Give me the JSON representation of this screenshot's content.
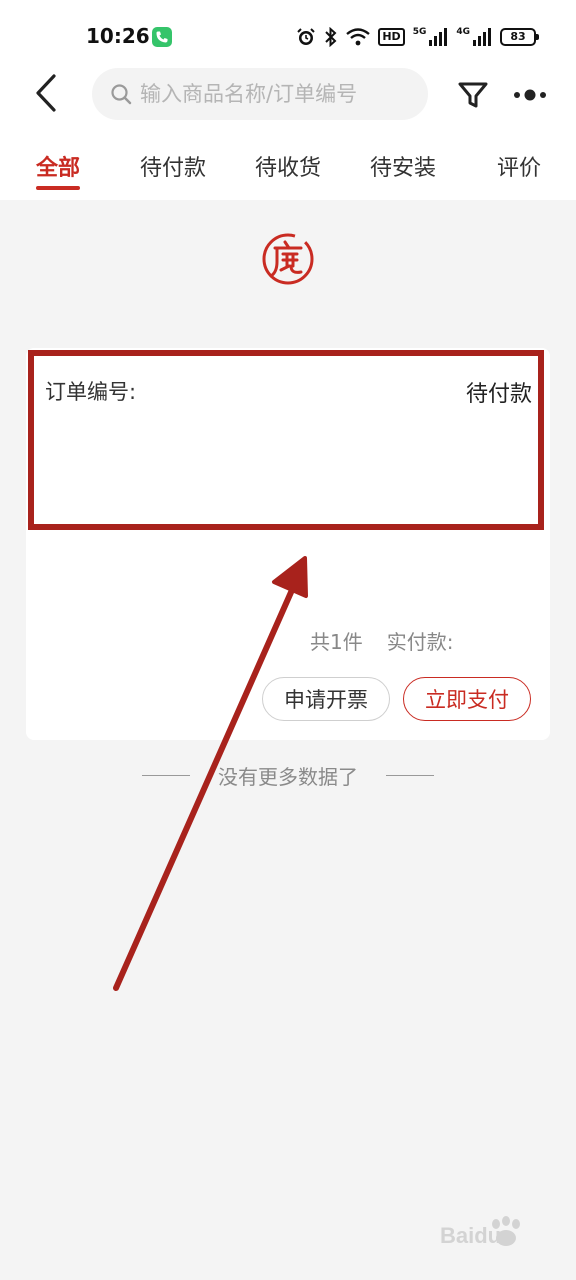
{
  "status_bar": {
    "time": "10:26",
    "hd_label": "HD",
    "net1": "5G",
    "net2": "4G",
    "battery": "83"
  },
  "header": {
    "search_placeholder": "输入商品名称/订单编号",
    "icons": [
      "back-icon",
      "search-icon",
      "filter-icon",
      "more-icon"
    ]
  },
  "tabs": [
    {
      "label": "全部",
      "active": true
    },
    {
      "label": "待付款",
      "active": false
    },
    {
      "label": "待收货",
      "active": false
    },
    {
      "label": "待安装",
      "active": false
    },
    {
      "label": "评价",
      "active": false
    }
  ],
  "order": {
    "order_no_label": "订单编号:",
    "status": "待付款",
    "item_count": "共1件",
    "paid_label": "实付款:",
    "invoice_button": "申请开票",
    "pay_button": "立即支付"
  },
  "footer_note": "没有更多数据了",
  "watermark": "Baidu",
  "colors": {
    "accent": "#c92b22",
    "annotation": "#a8221c",
    "background": "#f4f4f4"
  }
}
